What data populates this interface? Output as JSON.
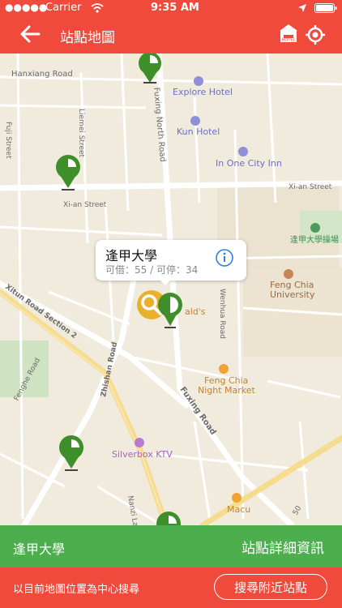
{
  "status": {
    "carrier": "Carrier",
    "time": "9:35 AM"
  },
  "nav": {
    "title": "站點地圖",
    "back_icon": "back-arrow-icon",
    "hotel_icon": "hotel-icon",
    "hotel_badge": "HOTEL",
    "locate_icon": "locate-icon"
  },
  "map": {
    "labels": {
      "hanxiang": "Hanxiang Road",
      "fuxing_north": "Fuxing North Road",
      "explore_hotel": "Explore Hotel",
      "kun_hotel": "Kun Hotel",
      "inone": "In One City Inn",
      "fuji": "Fuji Street",
      "liemei": "Liemei Street",
      "xian_left": "Xi-an Street",
      "xian_right": "Xi-an Street",
      "playground": "逢甲大學操場",
      "fengchia_univ_1": "Feng Chia",
      "fengchia_univ_2": "University",
      "wenhua": "Wenhua Road",
      "xitun": "Xitun Road Section 2",
      "fenghe": "Fenghe Road",
      "zhishan": "Zhishan Road",
      "mcdonalds": "ald's",
      "night_market_1": "Feng Chia",
      "night_market_2": "Night Market",
      "fuxing": "Fuxing Road",
      "silverbox": "Silverbox KTV",
      "macu": "Macu",
      "nanzi": "Nanzi Lane",
      "num50": "50"
    },
    "callout": {
      "name": "逢甲大學",
      "stats": "可借：55 / 可停：34"
    }
  },
  "bottom": {
    "station_name": "逢甲大學",
    "detail_button": "站點詳細資訊",
    "hint": "以目前地圖位置為中心搜尋",
    "search_button": "搜尋附近站點"
  },
  "colors": {
    "brand_red": "#ef4a3c",
    "brand_green": "#4cae4c",
    "pin_green": "#3e8f2a",
    "selected_yellow": "#e9b12b"
  }
}
